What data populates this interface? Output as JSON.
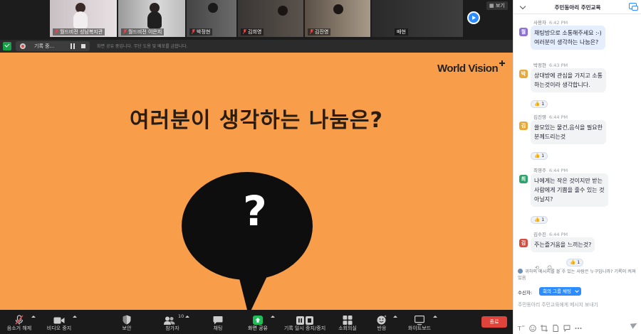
{
  "gallery": {
    "tiles": [
      {
        "name": "월드비전 성남복지관",
        "muted": true
      },
      {
        "name": "월드비전 이은지",
        "muted": true
      },
      {
        "name": "박정현",
        "muted": true
      },
      {
        "name": "김희영",
        "muted": true
      },
      {
        "name": "김진영",
        "muted": true
      },
      {
        "name": "배현",
        "muted": false
      }
    ],
    "view_label": "보기"
  },
  "share": {
    "recording_label": "기록 중...",
    "notice": "화면 공유 중입니다. 무단 도용 및 배포를 금합니다."
  },
  "slide": {
    "logo": "World Vision",
    "title": "여러분이 생각하는 나눔은?",
    "bubble_mark": "?",
    "background": "#f89d4a"
  },
  "toolbar": {
    "items": [
      {
        "label": "음소거 해제",
        "icon": "mic-muted-icon"
      },
      {
        "label": "비디오 중지",
        "icon": "video-icon"
      },
      {
        "label": "보안",
        "icon": "shield-icon"
      },
      {
        "label": "참가자",
        "icon": "participants-icon",
        "count": "10"
      },
      {
        "label": "채팅",
        "icon": "chat-icon"
      },
      {
        "label": "화면 공유",
        "icon": "share-screen-icon"
      },
      {
        "label": "기록 일시 중지/중지",
        "icon": "record-pause-icon"
      },
      {
        "label": "소회의실",
        "icon": "breakout-rooms-icon"
      },
      {
        "label": "반응",
        "icon": "reactions-icon"
      },
      {
        "label": "화이트보드",
        "icon": "whiteboard-icon"
      }
    ],
    "end_label": "종료"
  },
  "chat": {
    "title": "주민동아리 주민교육",
    "messages": [
      {
        "sender": "사용자",
        "time": "6:42 PM",
        "avatar": "월",
        "avatar_color": "#8e6fd6",
        "lines": [
          "채팅방으로 소통해주세요 :-)",
          "여러분이 생각하는 나눔은?"
        ],
        "self": true
      },
      {
        "sender": "박정현",
        "time": "6:43 PM",
        "avatar": "박",
        "avatar_color": "#e8a93a",
        "lines": [
          "상대방에 관심을 가지고 소통",
          "하는것이라 생각합니다."
        ],
        "reaction": "1"
      },
      {
        "sender": "김진영",
        "time": "6:44 PM",
        "avatar": "김",
        "avatar_color": "#e8a93a",
        "lines": [
          "쓸모있는 물건,음식을 필요한",
          "분께드리는것"
        ],
        "reaction": "1"
      },
      {
        "sender": "최영주",
        "time": "6:44 PM",
        "avatar": "최",
        "avatar_color": "#2fa36b",
        "lines": [
          "나에게는 작은 것이지만 받는",
          "사람에게 기쁨을 줄수 있는 것",
          "아닐지?"
        ],
        "reaction": "1"
      },
      {
        "sender": "김수진",
        "time": "6:44 PM",
        "avatar": "김",
        "avatar_color": "#d94b3d",
        "lines": [
          "주는즐거움을 느끼는것?"
        ],
        "reaction": "1"
      }
    ],
    "privacy_notice": "귀하의 메시지를 볼 수 있는 사람은 누구입니까? 기록이 켜져 있음",
    "recipient_label": "수신자:",
    "recipient_value": "회의 그룹 채팅",
    "input_placeholder": "주민동아리 주민교육에게 메시지 보내기"
  },
  "colors": {
    "accent": "#2d8cff",
    "end_button": "#e0433a",
    "slide_bg": "#f89d4a"
  }
}
